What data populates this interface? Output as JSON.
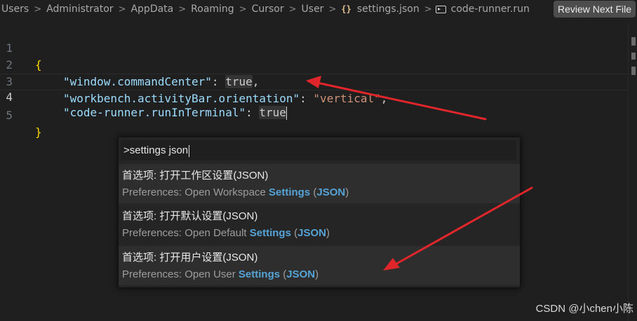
{
  "breadcrumb": {
    "items": [
      "Users",
      "Administrator",
      "AppData",
      "Roaming",
      "Cursor",
      "User"
    ],
    "file_icon": "{}",
    "file_name": "settings.json",
    "tab_icon": "code-runner-icon",
    "tab_name": "code-runner.run"
  },
  "toolbar": {
    "review_label": "Review Next File"
  },
  "editor": {
    "line_numbers": [
      "1",
      "2",
      "3",
      "4",
      "5"
    ],
    "lines": {
      "l1_open": "{",
      "l2_key": "\"window.commandCenter\"",
      "l2_colon": ": ",
      "l2_value": "true",
      "l2_comma": ",",
      "l3_key": "\"workbench.activityBar.orientation\"",
      "l3_colon": ": ",
      "l3_value": "\"vertical\"",
      "l3_comma": ",",
      "l4_key": "\"code-runner.runInTerminal\"",
      "l4_colon": ": ",
      "l4_value": "true",
      "l5_close": "}"
    }
  },
  "palette": {
    "query": ">settings json",
    "items": [
      {
        "primary": "首选项: 打开工作区设置(JSON)",
        "secondary_prefix": "Preferences: Open Workspace ",
        "hl1": "Settings",
        "paren_open": " (",
        "hl2": "JSON",
        "paren_close": ")"
      },
      {
        "primary": "首选项: 打开默认设置(JSON)",
        "secondary_prefix": "Preferences: Open Default ",
        "hl1": "Settings",
        "paren_open": " (",
        "hl2": "JSON",
        "paren_close": ")"
      },
      {
        "primary": "首选项: 打开用户设置(JSON)",
        "secondary_prefix": "Preferences: Open User ",
        "hl1": "Settings",
        "paren_open": " (",
        "hl2": "JSON",
        "paren_close": ")"
      }
    ]
  },
  "watermark": "CSDN @小chen小陈",
  "colors": {
    "background": "#1f1f1f",
    "key": "#9cdcfe",
    "string": "#ce9178",
    "brace": "#ffd700",
    "highlight": "#56a3d6",
    "arrow": "#e0262b"
  }
}
